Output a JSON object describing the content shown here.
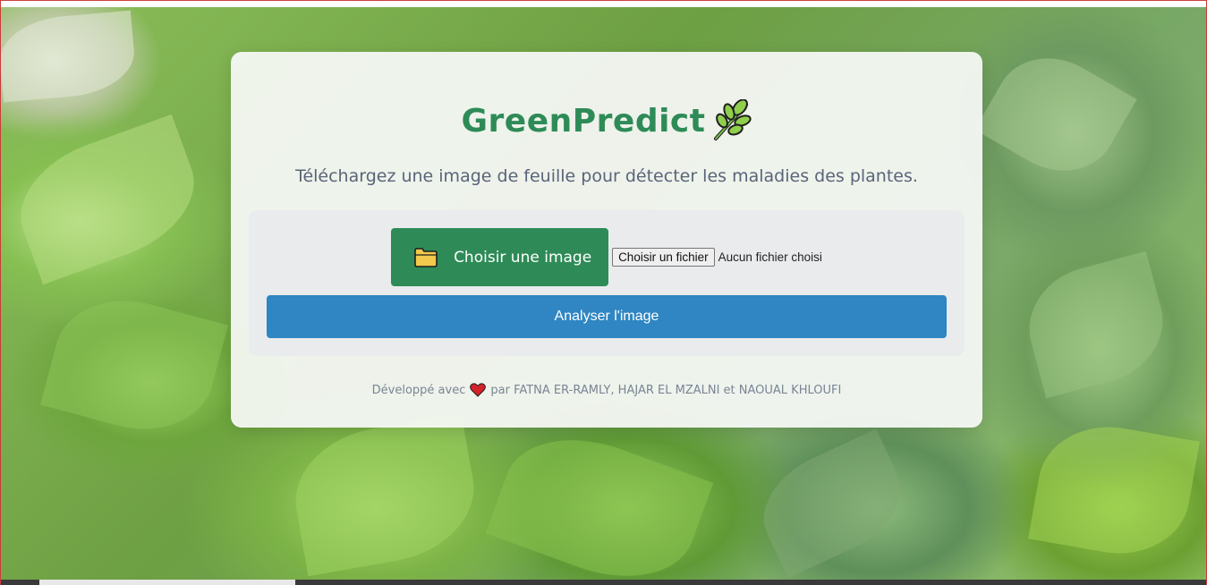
{
  "app": {
    "title": "GreenPredict",
    "title_icon": "herb-leaf-icon",
    "subtitle": "Téléchargez une image de feuille pour détecter les maladies des plantes."
  },
  "upload": {
    "choose_icon": "folder-icon",
    "choose_label": "Choisir une image",
    "file_button_label": "Choisir un fichier",
    "file_status": "Aucun fichier choisi",
    "analyze_label": "Analyser l'image"
  },
  "footer": {
    "prefix": "Développé avec",
    "heart_icon": "heart-icon",
    "suffix": "par FATNA ER-RAMLY, HAJAR EL MZALNI et NAOUAL KHLOUFI"
  },
  "colors": {
    "brand_green": "#2e8b57",
    "analyze_blue": "#2f86c3",
    "subtitle_gray": "#5a6478",
    "footer_gray": "#7a8594",
    "heart_red": "#d4222a"
  }
}
